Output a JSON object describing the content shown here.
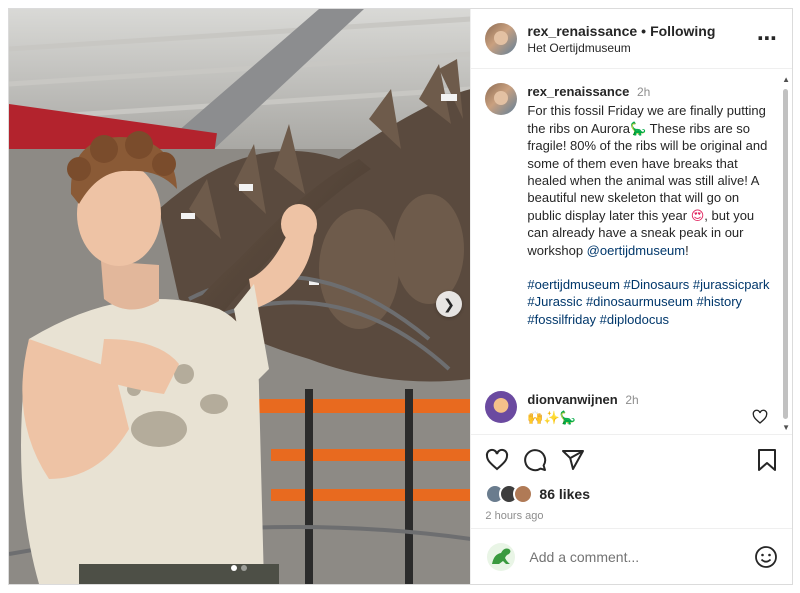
{
  "post": {
    "username": "rex_renaissance",
    "separator": "•",
    "follow_status": "Following",
    "location": "Het Oertijdmuseum",
    "more_icon": "more-horizontal-icon"
  },
  "caption": {
    "username": "rex_renaissance",
    "time": "2h",
    "text_1": "For this fossil Friday we are finally putting the ribs on Aurora",
    "emoji_1": "🦕",
    "text_2": " These ribs are so fragile! 80% of the ribs will be original and some of them even have breaks that healed when the animal was still alive! A beautiful new skeleton that will go on public display later this year ",
    "emoji_2": "😍",
    "text_3": ", but you can already have a sneak peak in our workshop ",
    "mention": "@oertijdmuseum",
    "text_4": "!",
    "hashtags": [
      "#oertijdmuseum",
      "#Dinosaurs",
      "#jurassicpark",
      "#Jurassic",
      "#dinosaurmuseum",
      "#history",
      "#fossilfriday",
      "#diplodocus"
    ]
  },
  "comment": {
    "username": "dionvanwijnen",
    "time": "2h",
    "reactions": "🙌✨🦕"
  },
  "stats": {
    "likes": "86 likes",
    "posted": "2 hours ago"
  },
  "composer": {
    "placeholder": "Add a comment..."
  },
  "carousel": {
    "slides": 2,
    "current": 1,
    "next_icon": "chevron-right-icon"
  },
  "colors": {
    "link": "#00376b",
    "muted": "#8e8e8e",
    "text": "#262626"
  }
}
